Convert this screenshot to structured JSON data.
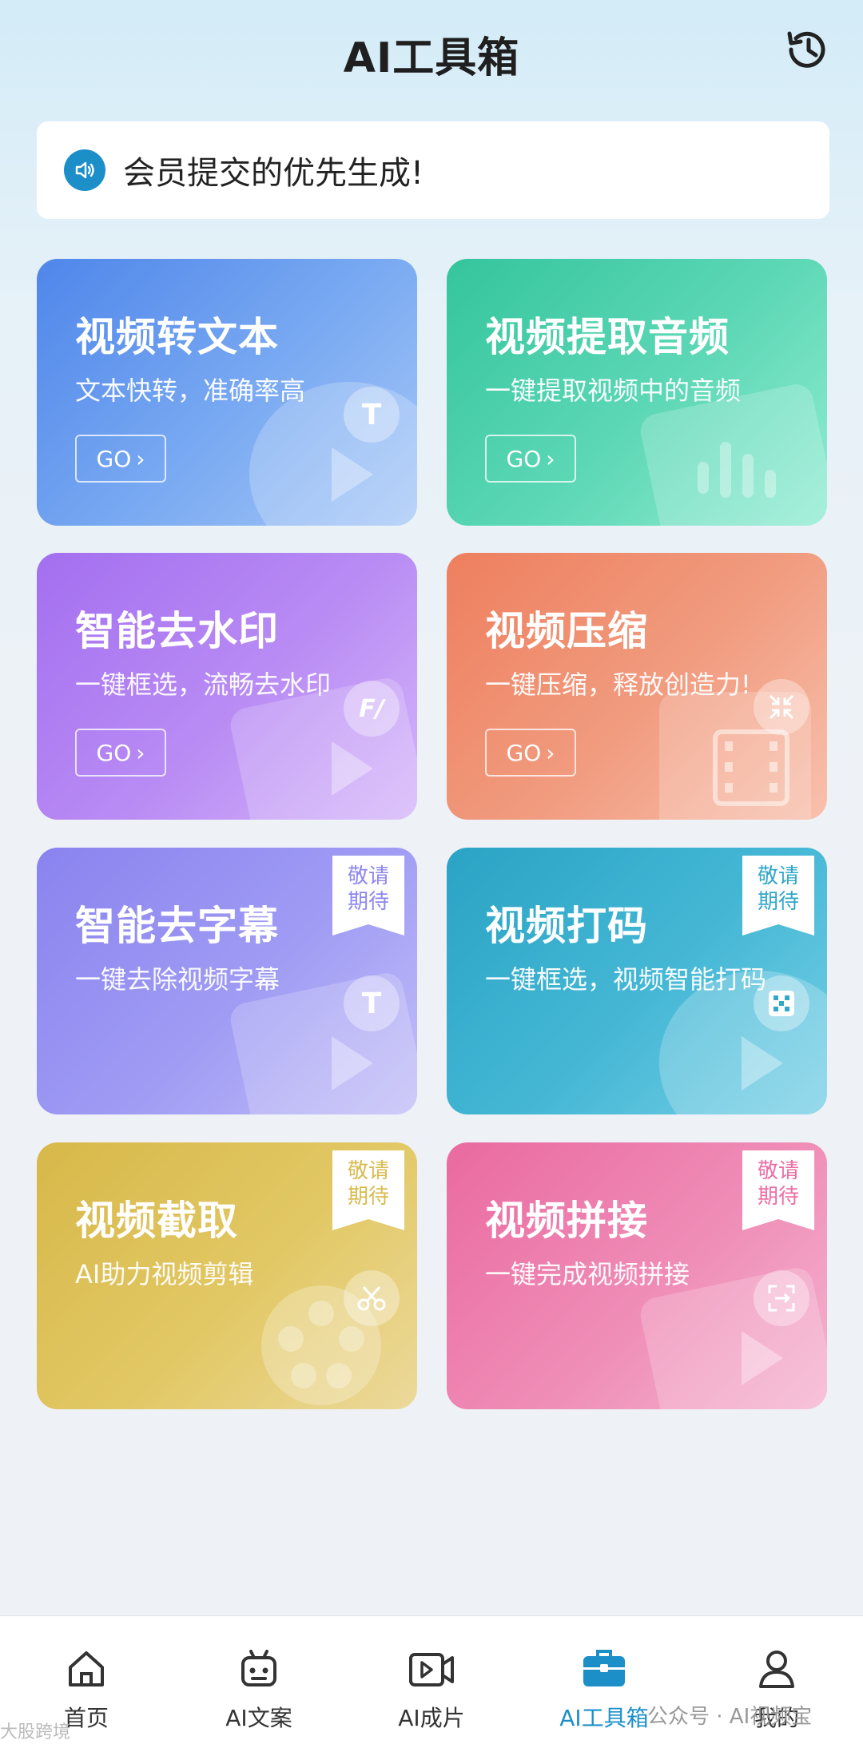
{
  "header": {
    "title": "AI工具箱",
    "history_icon": "history-clock-icon"
  },
  "notice": {
    "icon": "speaker-icon",
    "text": "会员提交的优先生成!"
  },
  "cards": [
    {
      "title": "视频转文本",
      "subtitle": "文本快转，准确率高",
      "go": "GO",
      "badge_icon": "text-t-icon",
      "color": "#5b8eec"
    },
    {
      "title": "视频提取音频",
      "subtitle": "一键提取视频中的音频",
      "go": "GO",
      "badge_icon": "audio-file-icon",
      "color": "#3fcaa3"
    },
    {
      "title": "智能去水印",
      "subtitle": "一键框选，流畅去水印",
      "go": "GO",
      "badge_icon": "watermark-icon",
      "color": "#a874f1"
    },
    {
      "title": "视频压缩",
      "subtitle": "一键压缩，释放创造力!",
      "go": "GO",
      "badge_icon": "compress-icon",
      "color": "#ef8463"
    },
    {
      "title": "智能去字幕",
      "subtitle": "一键去除视频字幕",
      "soon_line1": "敬请",
      "soon_line2": "期待",
      "badge_icon": "subtitle-t-icon",
      "color": "#8d87ef"
    },
    {
      "title": "视频打码",
      "subtitle": "一键框选，视频智能打码",
      "soon_line1": "敬请",
      "soon_line2": "期待",
      "badge_icon": "mosaic-icon",
      "color": "#31a8c8"
    },
    {
      "title": "视频截取",
      "subtitle": "AI助力视频剪辑",
      "soon_line1": "敬请",
      "soon_line2": "期待",
      "badge_icon": "scissors-icon",
      "color": "#d9bb4f"
    },
    {
      "title": "视频拼接",
      "subtitle": "一键完成视频拼接",
      "soon_line1": "敬请",
      "soon_line2": "期待",
      "badge_icon": "splice-icon",
      "color": "#eb6fa4"
    }
  ],
  "tabbar": {
    "items": [
      {
        "label": "首页",
        "icon": "home-icon"
      },
      {
        "label": "AI文案",
        "icon": "robot-icon"
      },
      {
        "label": "AI成片",
        "icon": "video-camera-icon"
      },
      {
        "label": "AI工具箱",
        "icon": "toolbox-icon",
        "active": true
      },
      {
        "label": "我的",
        "icon": "user-icon"
      }
    ]
  },
  "watermarks": {
    "left": "大股跨境",
    "right": "公众号 · AI视频宝"
  }
}
